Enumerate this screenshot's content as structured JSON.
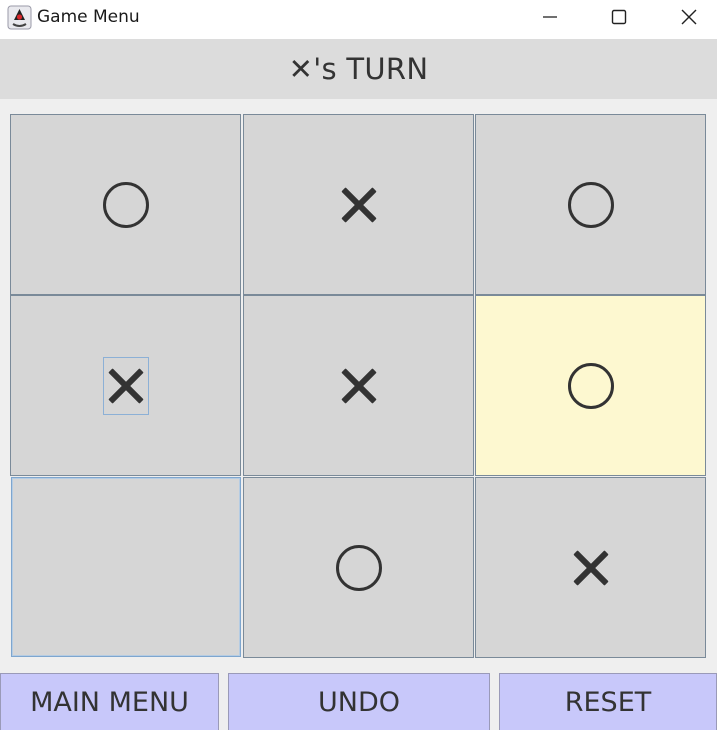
{
  "window": {
    "title": "Game Menu",
    "icon": "java-duke-icon",
    "controls": [
      "minimize",
      "maximize",
      "close"
    ]
  },
  "status": {
    "text": "✕'s TURN"
  },
  "board": {
    "cells": [
      {
        "mark": "O",
        "highlighted": false,
        "focused": false
      },
      {
        "mark": "X",
        "highlighted": false,
        "focused": false
      },
      {
        "mark": "O",
        "highlighted": false,
        "focused": false
      },
      {
        "mark": "X",
        "highlighted": false,
        "focused": true
      },
      {
        "mark": "X",
        "highlighted": false,
        "focused": false
      },
      {
        "mark": "O",
        "highlighted": true,
        "focused": false
      },
      {
        "mark": "",
        "highlighted": false,
        "focused": true
      },
      {
        "mark": "O",
        "highlighted": false,
        "focused": false
      },
      {
        "mark": "X",
        "highlighted": false,
        "focused": false
      }
    ],
    "colors": {
      "cell": "#d6d6d6",
      "highlight": "#fdf8d0",
      "mark": "#333333"
    }
  },
  "buttons": {
    "main_menu": "MAIN MENU",
    "undo": "UNDO",
    "reset": "RESET",
    "color": "#c8c8fa"
  }
}
